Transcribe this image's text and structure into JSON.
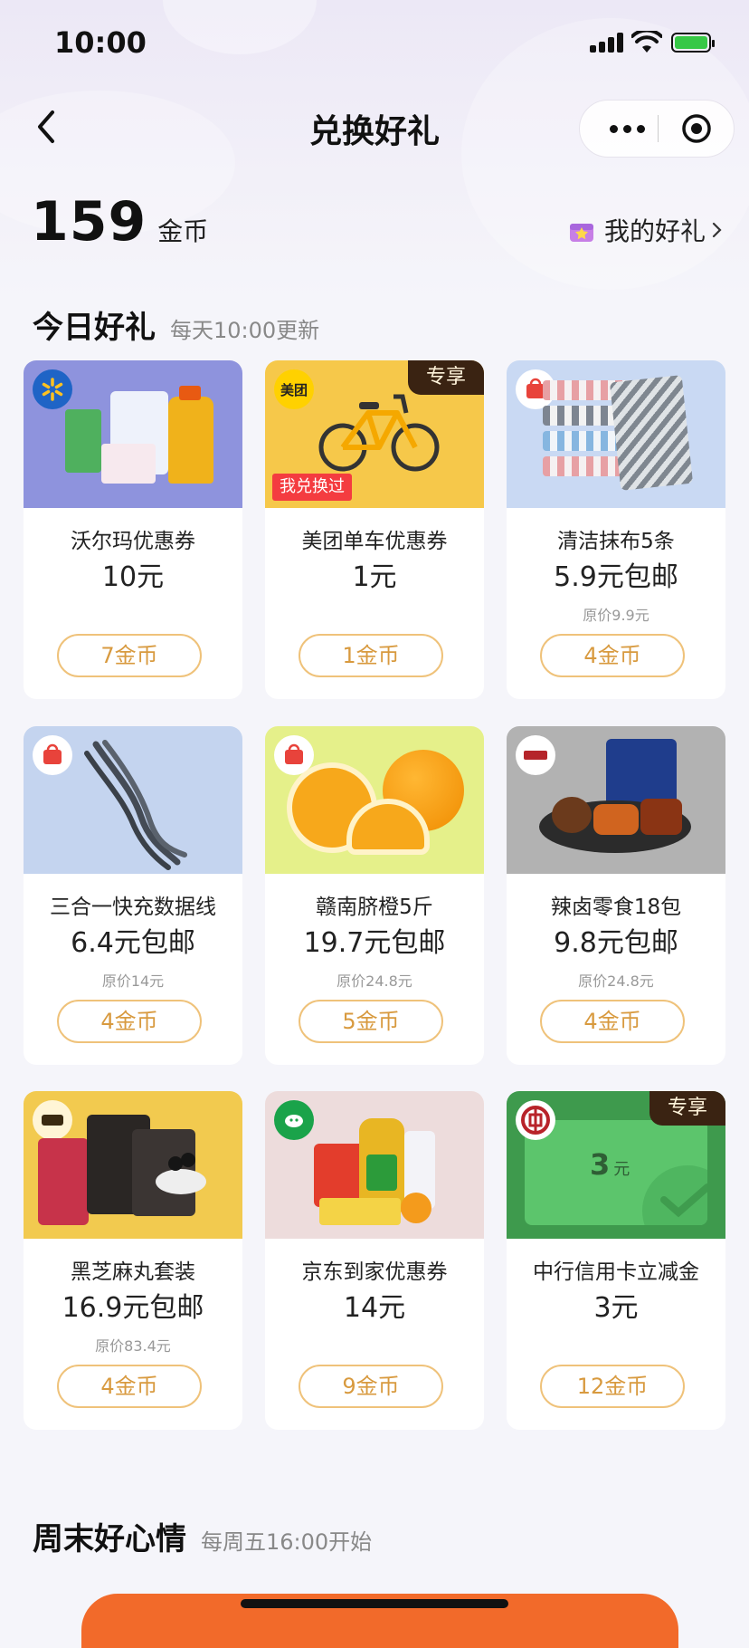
{
  "status_bar": {
    "time": "10:00"
  },
  "nav": {
    "title": "兑换好礼"
  },
  "balance": {
    "amount": "159",
    "unit": "金币"
  },
  "my_gifts_label": "我的好礼",
  "today": {
    "title": "今日好礼",
    "subtitle": "每天10:00更新"
  },
  "weekend": {
    "title": "周末好心情",
    "subtitle": "每周五16:00开始"
  },
  "labels": {
    "exclusive": "专享",
    "redeemed": "我兑换过",
    "meituan": "美团",
    "voucher_amount": "3",
    "voucher_unit": "元"
  },
  "items": [
    {
      "name": "沃尔玛优惠券",
      "price": "10元",
      "original": "",
      "cost": "7金币"
    },
    {
      "name": "美团单车优惠券",
      "price": "1元",
      "original": "",
      "cost": "1金币"
    },
    {
      "name": "清洁抹布5条",
      "price": "5.9元包邮",
      "original": "原价9.9元",
      "cost": "4金币"
    },
    {
      "name": "三合一快充数据线",
      "price": "6.4元包邮",
      "original": "原价14元",
      "cost": "4金币"
    },
    {
      "name": "赣南脐橙5斤",
      "price": "19.7元包邮",
      "original": "原价24.8元",
      "cost": "5金币"
    },
    {
      "name": "辣卤零食18包",
      "price": "9.8元包邮",
      "original": "原价24.8元",
      "cost": "4金币"
    },
    {
      "name": "黑芝麻丸套装",
      "price": "16.9元包邮",
      "original": "原价83.4元",
      "cost": "4金币"
    },
    {
      "name": "京东到家优惠券",
      "price": "14元",
      "original": "",
      "cost": "9金币"
    },
    {
      "name": "中行信用卡立减金",
      "price": "3元",
      "original": "",
      "cost": "12金币"
    }
  ]
}
